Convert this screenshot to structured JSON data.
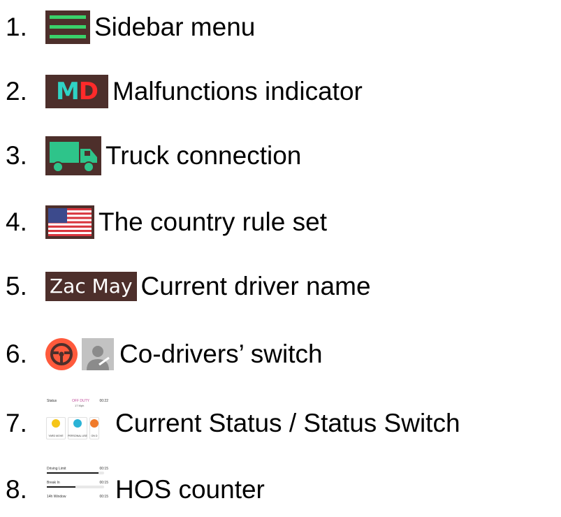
{
  "items": [
    {
      "number": "1.",
      "label": "Sidebar menu",
      "icon": "hamburger-menu-icon"
    },
    {
      "number": "2.",
      "label": "Malfunctions indicator",
      "icon": "md-indicator-icon",
      "icon_text_m": "M",
      "icon_text_d": "D"
    },
    {
      "number": "3.",
      "label": "Truck connection",
      "icon": "truck-icon"
    },
    {
      "number": "4.",
      "label": "The country rule set",
      "icon": "us-flag-icon"
    },
    {
      "number": "5.",
      "label": "Current driver name",
      "badge_text": "Zac May"
    },
    {
      "number": "6.",
      "label": "Co-drivers’ switch",
      "icon": "steering-wheel-icon"
    },
    {
      "number": "7.",
      "label": "Current Status / Status Switch"
    },
    {
      "number": "8.",
      "label": "HOS counter"
    }
  ],
  "status_card": {
    "status_label": "Status",
    "status_value": "OFF DUTY",
    "time": "00:22",
    "speed": "17 Mph",
    "buttons": [
      {
        "label": "YARD MOVE",
        "color": "#f5c518"
      },
      {
        "label": "PERSONAL USE",
        "color": "#2bb3d6"
      },
      {
        "label": "ON D",
        "color": "#f07a2a"
      }
    ]
  },
  "hos": {
    "rows": [
      {
        "label": "Driving Limit",
        "time": "00:15",
        "progress": 0.9
      },
      {
        "label": "Break In",
        "time": "00:15",
        "progress": 0.5
      },
      {
        "label": "14h Window",
        "time": "00:15",
        "progress": 0.0
      }
    ]
  },
  "colors": {
    "icon_background": "#4d2f2b",
    "menu_lines": "#3ad16a",
    "truck": "#2ec48a",
    "steering_wheel": "#ff5a3c",
    "md_m": "#2fd3c4",
    "md_d": "#ff2a2a"
  }
}
